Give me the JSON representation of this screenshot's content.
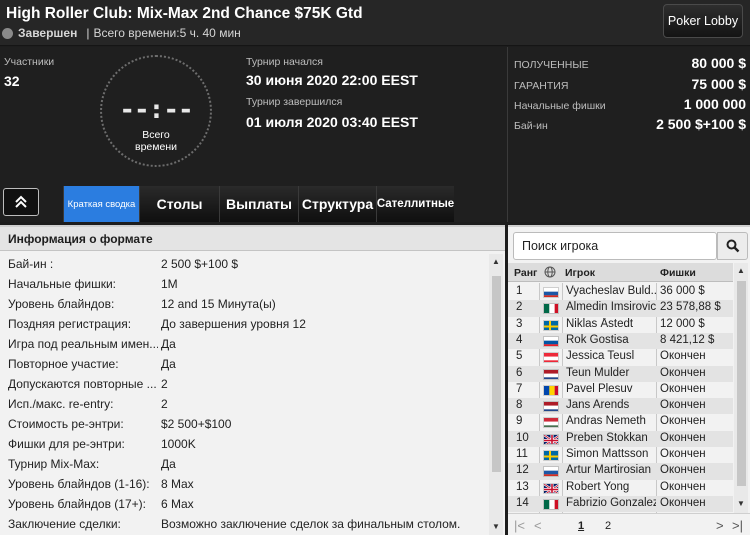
{
  "header": {
    "title": "High Roller Club: Mix-Max 2nd Chance $75K Gtd",
    "status_label": "Завершен",
    "separator": "|",
    "total_time": "Всего времени:5 ч. 40 мин",
    "lobby_button": "Poker Lobby"
  },
  "info": {
    "participants_label": "Участники",
    "participants_value": "32",
    "clock_digits": "--:--",
    "clock_label_1": "Всего",
    "clock_label_2": "времени",
    "started_label": "Турнир начался",
    "started_value": "30 июня 2020  22:00 EEST",
    "ended_label": "Турнир завершился",
    "ended_value": "01 июля 2020  03:40 EEST",
    "stats": [
      {
        "label": "ПОЛУЧЕННЫЕ",
        "value": "80 000 $"
      },
      {
        "label": "ГАРАНТИЯ",
        "value": "75 000 $"
      },
      {
        "label": "Начальные фишки",
        "value": "1 000 000"
      },
      {
        "label": "Бай-ин",
        "value": "2 500 $+100 $"
      }
    ]
  },
  "tabs": [
    {
      "label": "Краткая сводка",
      "active": true
    },
    {
      "label": "Столы",
      "active": false
    },
    {
      "label": "Выплаты",
      "active": false
    },
    {
      "label": "Структура",
      "active": false
    },
    {
      "label": "Сателлитные",
      "active": false
    }
  ],
  "format": {
    "title": "Информация о формате",
    "rows": [
      {
        "key": "Бай-ин :",
        "value": "2 500 $+100 $"
      },
      {
        "key": "Начальные фишки:",
        "value": "1M"
      },
      {
        "key": "Уровень блайндов:",
        "value": "12 and 15 Минута(ы)"
      },
      {
        "key": "Поздняя регистрация:",
        "value": "До завершения уровня 12"
      },
      {
        "key": "Игра под реальным имен...",
        "value": "Да"
      },
      {
        "key": "Повторное участие:",
        "value": "Да"
      },
      {
        "key": "Допускаются повторные ...",
        "value": "2"
      },
      {
        "key": "Исп./макс. re-entry:",
        "value": "2"
      },
      {
        "key": "Стоимость ре-энтри:",
        "value": "$2 500+$100"
      },
      {
        "key": "Фишки для ре-энтри:",
        "value": "1000K"
      },
      {
        "key": "Турнир Mix-Max:",
        "value": "Да"
      },
      {
        "key": "Уровень блайндов (1-16):",
        "value": "8 Max"
      },
      {
        "key": "Уровень блайндов (17+):",
        "value": "6 Max"
      },
      {
        "key": "Заключение сделки:",
        "value": "Возможно заключение сделок за финальным столом."
      }
    ]
  },
  "players": {
    "search_placeholder": "Поиск игрока",
    "col_rank": "Ранг",
    "col_player": "Игрок",
    "col_chips": "Фишки",
    "rows": [
      {
        "rank": "1",
        "flag": "ru",
        "name": "Vyacheslav Buld..",
        "chips": "36 000 $"
      },
      {
        "rank": "2",
        "flag": "mx",
        "name": "Almedin Imsirovic",
        "chips": "23 578,88 $"
      },
      {
        "rank": "3",
        "flag": "se",
        "name": "Niklas Åstedt",
        "chips": "12 000 $"
      },
      {
        "rank": "4",
        "flag": "si",
        "name": "Rok Gostisa",
        "chips": "8 421,12 $"
      },
      {
        "rank": "5",
        "flag": "at",
        "name": "Jessica Teusl",
        "chips": "Окончен"
      },
      {
        "rank": "6",
        "flag": "nl",
        "name": "Teun Mulder",
        "chips": "Окончен"
      },
      {
        "rank": "7",
        "flag": "md",
        "name": "Pavel Plesuv",
        "chips": "Окончен"
      },
      {
        "rank": "8",
        "flag": "nl",
        "name": "Jans Arends",
        "chips": "Окончен"
      },
      {
        "rank": "9",
        "flag": "hu",
        "name": "Andras Nemeth",
        "chips": "Окончен"
      },
      {
        "rank": "10",
        "flag": "gb",
        "name": "Preben Stokkan",
        "chips": "Окончен"
      },
      {
        "rank": "11",
        "flag": "se",
        "name": "Simon Mattsson",
        "chips": "Окончен"
      },
      {
        "rank": "12",
        "flag": "ru",
        "name": "Artur Martirosian",
        "chips": "Окончен"
      },
      {
        "rank": "13",
        "flag": "gb",
        "name": "Robert Yong",
        "chips": "Окончен"
      },
      {
        "rank": "14",
        "flag": "mx",
        "name": "Fabrizio Gonzalez",
        "chips": "Окончен"
      }
    ],
    "page_1": "1",
    "page_2": "2"
  }
}
